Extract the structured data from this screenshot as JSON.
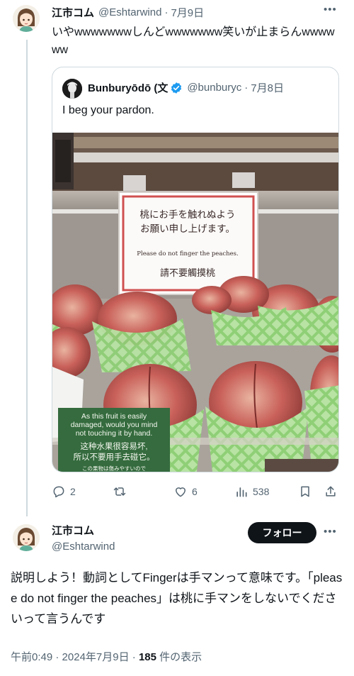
{
  "reply_to_post": {
    "author_name": "江市コム",
    "author_handle": "@Eshtarwind",
    "separator": "·",
    "date": "7月9日",
    "text": "いやwwwwwwwしんどwwwwwww笑いが止まらんwwwwww",
    "quoted_post": {
      "author_name": "Bunburyōdō (文",
      "author_handle": "@bunburyc",
      "date": "7月8日",
      "text": "I beg your pardon.",
      "image": {
        "description_icon": "peaches-photo",
        "sign": {
          "japanese_lines": [
            "桃にお手を触れぬよう",
            "お願い申し上げます。"
          ],
          "english": "Please do not finger the peaches.",
          "chinese": "請不要觸摸桃"
        },
        "green_sign": {
          "english_lines": [
            "As this fruit is easily",
            "damaged, would you mind",
            "not touching it by hand."
          ],
          "chinese_lines": [
            "这种水果很容易坏,",
            "所以不要用手去碰它。"
          ],
          "japanese_line": "この果物は傷みやすいので"
        }
      }
    },
    "actions": {
      "replies": "2",
      "reposts": "",
      "likes": "6",
      "views": "538"
    }
  },
  "main_post": {
    "author_name": "江市コム",
    "author_handle": "@Eshtarwind",
    "follow_label": "フォロー",
    "text": "説明しよう！動詞としてFingerは手マンって意味です。「please do not finger the peaches」は桃に手マンをしないでくださいって言うんです",
    "time": "午前0:49",
    "separator": "·",
    "date": "2024年7月9日",
    "views_count": "185",
    "views_label": " 件の表示"
  },
  "colors": {
    "text": "#0f1419",
    "secondary": "#536471",
    "border": "#cfd9de",
    "verified": "#1d9bf0",
    "follow_bg": "#0f1419"
  }
}
